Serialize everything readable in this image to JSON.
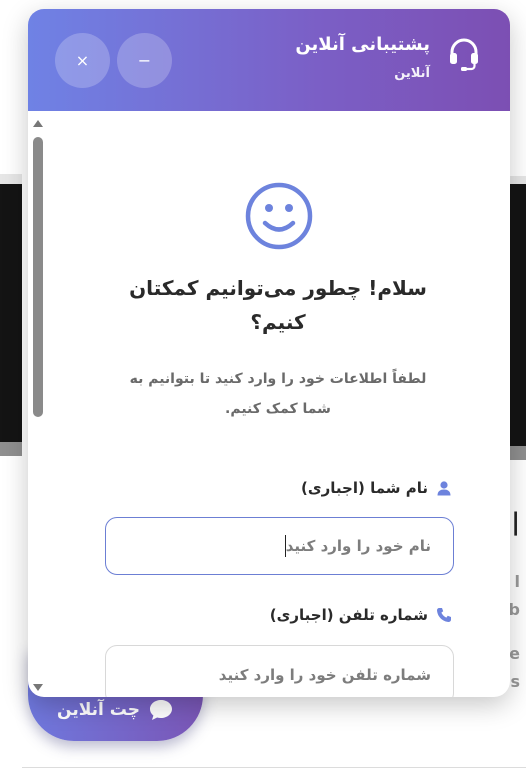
{
  "panel": {
    "title": "پشتیبانی آنلاین",
    "status": "آنلاین",
    "close_icon": "×",
    "minimize_icon": "−"
  },
  "welcome": {
    "title_line1": "سلام! چطور می‌توانیم کمکتان",
    "title_line2": "کنیم؟",
    "subtitle_line1": "لطفاً اطلاعات خود را وارد کنید تا بتوانیم به",
    "subtitle_line2": "شما کمک کنیم."
  },
  "form": {
    "name_label": "نام شما (اجباری)",
    "name_placeholder": "نام خود را وارد کنید",
    "phone_label": "شماره تلفن (اجباری)",
    "phone_placeholder": "شماره تلفن خود را وارد کنید"
  },
  "launcher": {
    "label": "چت آنلاین"
  },
  "colors": {
    "header_start": "#6f82e5",
    "header_end": "#7c4fb3",
    "accent": "#6c7fd4"
  },
  "icons": {
    "header": "headset-icon",
    "welcome": "smile-icon",
    "name_field": "user-icon",
    "phone_field": "phone-icon",
    "launcher": "chat-bubble-icon"
  }
}
